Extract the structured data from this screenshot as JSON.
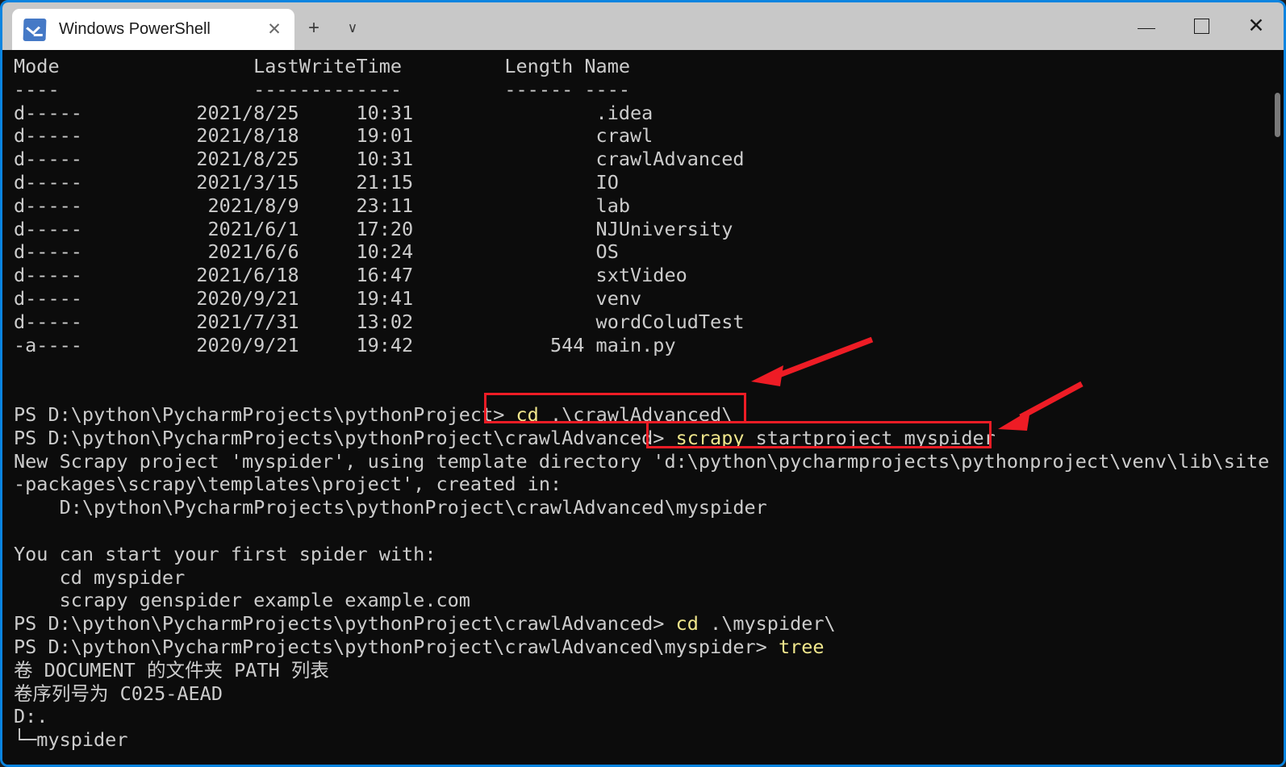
{
  "window": {
    "border_color": "#0a84e0",
    "titlebar_bg": "#c8c8c8",
    "console_bg": "#0c0c0c",
    "text_color": "#cccccc",
    "command_color": "#f0e68c",
    "annotation_color": "#ee1c25"
  },
  "titlebar": {
    "tab": {
      "icon": "powershell-icon",
      "title": "Windows PowerShell",
      "close_glyph": "✕"
    },
    "new_tab_glyph": "+",
    "dropdown_glyph": "∨",
    "minimize_glyph": "—",
    "maximize_glyph": "□",
    "close_glyph": "✕"
  },
  "console": {
    "lines": [
      {
        "id": "hdr-cols",
        "text": "Mode                 LastWriteTime         Length Name"
      },
      {
        "id": "hdr-rule",
        "text": "----                 -------------         ------ ----"
      },
      {
        "id": "row-idea",
        "text": "d-----          2021/8/25     10:31                .idea"
      },
      {
        "id": "row-crawl",
        "text": "d-----          2021/8/18     19:01                crawl"
      },
      {
        "id": "row-crawladv",
        "text": "d-----          2021/8/25     10:31                crawlAdvanced"
      },
      {
        "id": "row-io",
        "text": "d-----          2021/3/15     21:15                IO"
      },
      {
        "id": "row-lab",
        "text": "d-----           2021/8/9     23:11                lab"
      },
      {
        "id": "row-nju",
        "text": "d-----           2021/6/1     17:20                NJUniversity"
      },
      {
        "id": "row-os",
        "text": "d-----           2021/6/6     10:24                OS"
      },
      {
        "id": "row-sxt",
        "text": "d-----          2021/6/18     16:47                sxtVideo"
      },
      {
        "id": "row-venv",
        "text": "d-----          2020/9/21     19:41                venv"
      },
      {
        "id": "row-wordcloud",
        "text": "d-----          2021/7/31     13:02                wordColudTest"
      },
      {
        "id": "row-mainpy",
        "text": "-a----          2020/9/21     19:42            544 main.py"
      },
      {
        "id": "blank-1",
        "text": ""
      },
      {
        "id": "blank-2",
        "text": ""
      },
      {
        "id": "prompt-cd-crawladv",
        "segments": [
          {
            "text": "PS D:\\python\\PycharmProjects\\pythonProject> ",
            "style": "gray"
          },
          {
            "text": "cd",
            "style": "yellow"
          },
          {
            "text": " .\\crawlAdvanced\\",
            "style": "gray"
          }
        ]
      },
      {
        "id": "prompt-startproject",
        "segments": [
          {
            "text": "PS D:\\python\\PycharmProjects\\pythonProject\\crawlAdvanced> ",
            "style": "gray"
          },
          {
            "text": "scrapy",
            "style": "yellow"
          },
          {
            "text": " startproject myspider",
            "style": "gray"
          }
        ]
      },
      {
        "id": "out-newproject",
        "text": "New Scrapy project 'myspider', using template directory 'd:\\python\\pycharmprojects\\pythonproject\\venv\\lib\\site"
      },
      {
        "id": "out-packages",
        "text": "-packages\\scrapy\\templates\\project', created in:"
      },
      {
        "id": "out-createdpath",
        "text": "    D:\\python\\PycharmProjects\\pythonProject\\crawlAdvanced\\myspider"
      },
      {
        "id": "blank-3",
        "text": ""
      },
      {
        "id": "out-startspider",
        "text": "You can start your first spider with:"
      },
      {
        "id": "out-cdmyspider",
        "text": "    cd myspider"
      },
      {
        "id": "out-genspider",
        "text": "    scrapy genspider example example.com"
      },
      {
        "id": "prompt-cd-myspider",
        "segments": [
          {
            "text": "PS D:\\python\\PycharmProjects\\pythonProject\\crawlAdvanced> ",
            "style": "gray"
          },
          {
            "text": "cd",
            "style": "yellow"
          },
          {
            "text": " .\\myspider\\",
            "style": "gray"
          }
        ]
      },
      {
        "id": "prompt-tree",
        "segments": [
          {
            "text": "PS D:\\python\\PycharmProjects\\pythonProject\\crawlAdvanced\\myspider> ",
            "style": "gray"
          },
          {
            "text": "tree",
            "style": "yellow"
          }
        ]
      },
      {
        "id": "out-volpath",
        "text": "卷 DOCUMENT 的文件夹 PATH 列表"
      },
      {
        "id": "out-volserial",
        "text": "卷序列号为 C025-AEAD"
      },
      {
        "id": "out-droot",
        "text": "D:."
      },
      {
        "id": "out-treeitem",
        "text": "└─myspider"
      }
    ]
  },
  "annotations": {
    "boxes": [
      {
        "id": "highlight-cd-crawladvanced",
        "label": "cd .\\crawlAdvanced\\"
      },
      {
        "id": "highlight-scrapy-startproject",
        "label": "scrapy startproject myspider"
      }
    ],
    "arrows": [
      {
        "id": "arrow-to-cd-command"
      },
      {
        "id": "arrow-to-startproject-command"
      }
    ]
  }
}
